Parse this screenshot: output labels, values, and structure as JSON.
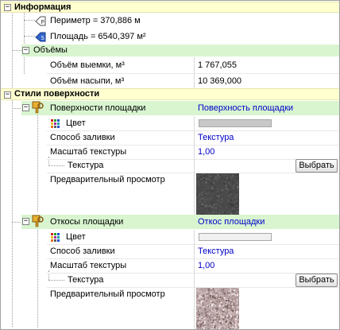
{
  "sections": {
    "info": {
      "title": "Информация",
      "perimeter": "Периметр = 370,886 м",
      "area": "Площадь = 6540,397 м²",
      "volumes": {
        "title": "Объёмы",
        "cut_label": "Объём выемки, м³",
        "cut_value": "1 767,055",
        "fill_label": "Объём насыпи, м³",
        "fill_value": "10 369,000"
      }
    },
    "styles": {
      "title": "Стили поверхности",
      "platform": {
        "title": "Поверхности площадки",
        "title_value": "Поверхность площадки",
        "color_label": "Цвет",
        "color_value": "#c8c8c8",
        "fill_label": "Способ заливки",
        "fill_value": "Текстура",
        "scale_label": "Масштаб текстуры",
        "scale_value": "1,00",
        "texture_label": "Текстура",
        "texture_button": "Выбрать",
        "preview_label": "Предварительный просмотр",
        "preview_texture": "dark-gray-asphalt"
      },
      "slopes": {
        "title": "Откосы площадки",
        "title_value": "Откос площадки",
        "color_label": "Цвет",
        "color_value": "#f0f0f0",
        "fill_label": "Способ заливки",
        "fill_value": "Текстура",
        "scale_label": "Масштаб текстуры",
        "scale_value": "1,00",
        "texture_label": "Текстура",
        "texture_button": "Выбрать",
        "preview_label": "Предварительный просмотр",
        "preview_texture": "pink-gravel"
      }
    }
  },
  "colors": {
    "category_bg": "#ffffd0",
    "group_bg": "#d8f5d0",
    "value_text": "#0000c8"
  }
}
